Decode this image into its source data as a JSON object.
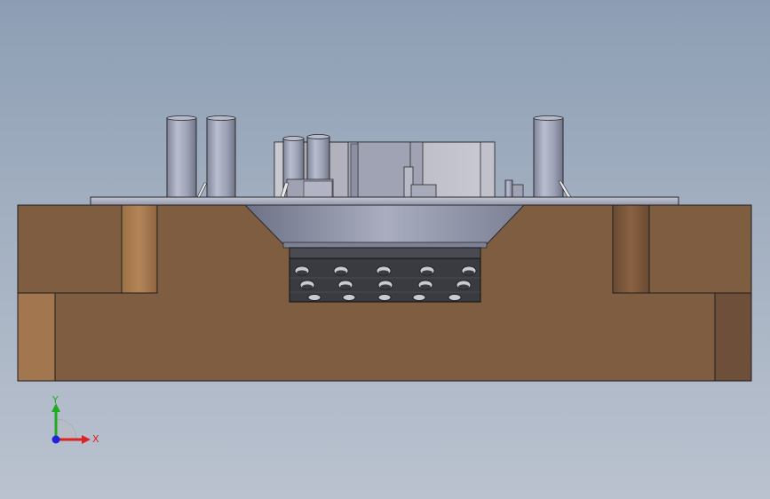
{
  "viewport": {
    "background_top": "#8d9eb4",
    "background_bottom": "#bac2cf"
  },
  "model": {
    "base_color": "#7e5d40",
    "base_light_color": "#a27750",
    "base_dark_color": "#6e4f3a",
    "metal_color": "#9ea3b8",
    "punch_block_color": "#3a3b40"
  },
  "triad": {
    "y_label": "Y",
    "x_label": "X",
    "y_color": "#22aa22",
    "x_color": "#dd2222",
    "z_color": "#2222dd"
  }
}
